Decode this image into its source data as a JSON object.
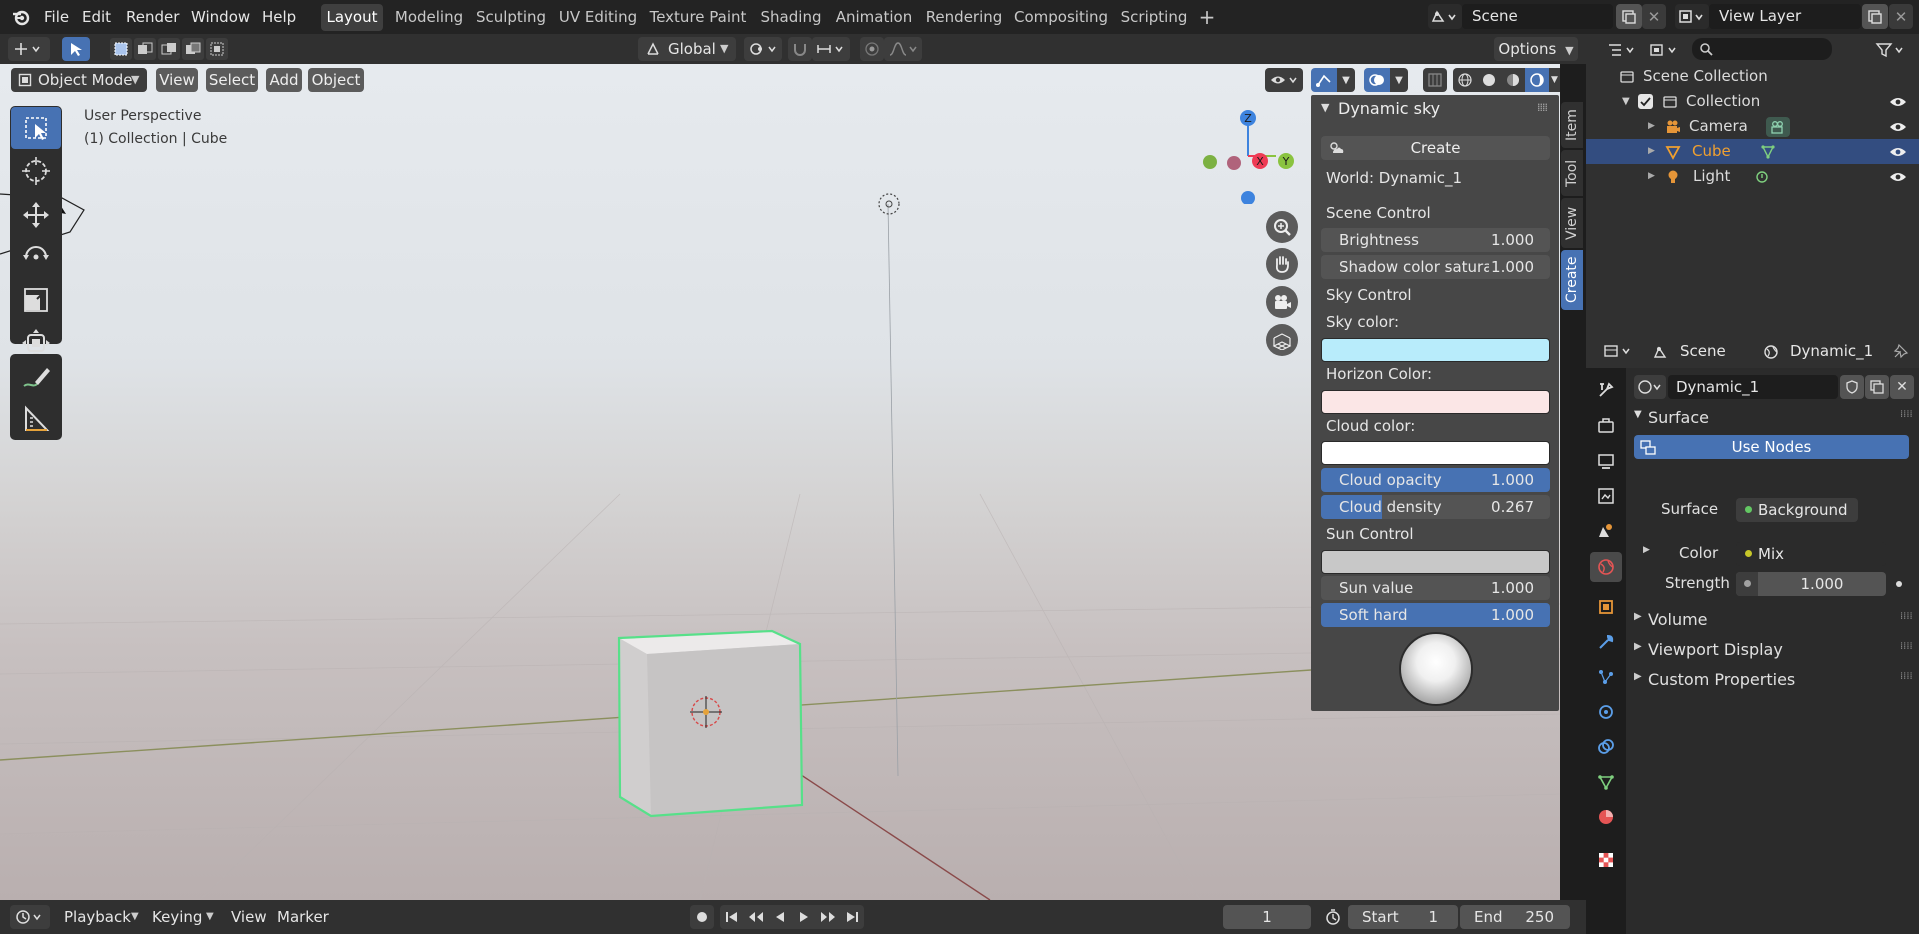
{
  "topbar": {
    "menus": [
      "File",
      "Edit",
      "Render",
      "Window",
      "Help"
    ],
    "workspaces": [
      "Layout",
      "Modeling",
      "Sculpting",
      "UV Editing",
      "Texture Paint",
      "Shading",
      "Animation",
      "Rendering",
      "Compositing",
      "Scripting"
    ],
    "active_workspace": "Layout",
    "add_tab_symbol": "+",
    "scene_name": "Scene",
    "view_layer_name": "View Layer"
  },
  "header": {
    "orientation": "Global",
    "options_label": "Options"
  },
  "viewport": {
    "mode_label": "Object Mode",
    "menus": [
      "View",
      "Select",
      "Add",
      "Object"
    ],
    "perspective_text": "User Perspective",
    "collection_text": "(1) Collection | Cube",
    "gizmo": {
      "z": "Z",
      "x": "X",
      "y": "Y"
    }
  },
  "sidebar_tabs": [
    "Item",
    "Tool",
    "View",
    "Create"
  ],
  "active_sidebar_tab": "Create",
  "dynamic_sky": {
    "title": "Dynamic sky",
    "create_label": "Create",
    "world_label": "World: Dynamic_1",
    "scene_control": "Scene Control",
    "brightness_label": "Brightness",
    "brightness_value": "1.000",
    "shadow_label": "Shadow color saturatio",
    "shadow_value": "1.000",
    "sky_control": "Sky Control",
    "sky_color_label": "Sky color:",
    "sky_color": "#b8ecfb",
    "horizon_color_label": "Horizon Color:",
    "horizon_color": "#fbe6e6",
    "cloud_color_label": "Cloud color:",
    "cloud_color": "#ffffff",
    "cloud_opacity_label": "Cloud opacity",
    "cloud_opacity_value": "1.000",
    "cloud_density_label": "Cloud density",
    "cloud_density_value": "0.267",
    "sun_control": "Sun Control",
    "sun_color": "#c8c8c8",
    "sun_value_label": "Sun value",
    "sun_value": "1.000",
    "soft_hard_label": "Soft hard",
    "soft_hard_value": "1.000"
  },
  "outliner": {
    "root": "Scene Collection",
    "collection": "Collection",
    "items": [
      "Camera",
      "Cube",
      "Light"
    ],
    "selected": "Cube"
  },
  "properties": {
    "scene_label": "Scene",
    "world_label": "Dynamic_1",
    "world_name": "Dynamic_1",
    "surface_section": "Surface",
    "use_nodes_label": "Use Nodes",
    "surface_label": "Surface",
    "surface_value": "Background",
    "color_label": "Color",
    "color_value": "Mix",
    "strength_label": "Strength",
    "strength_value": "1.000",
    "sections": [
      "Volume",
      "Viewport Display",
      "Custom Properties"
    ]
  },
  "timeline": {
    "menus": [
      "Playback",
      "Keying",
      "View",
      "Marker"
    ],
    "current_frame": "1",
    "start_label": "Start",
    "start_value": "1",
    "end_label": "End",
    "end_value": "250"
  },
  "colors": {
    "accent_blue": "#4772b3",
    "selected_orange": "#f0a030",
    "x_axis": "#ee3b55",
    "y_axis": "#8ac33f",
    "z_axis": "#3d83de"
  }
}
